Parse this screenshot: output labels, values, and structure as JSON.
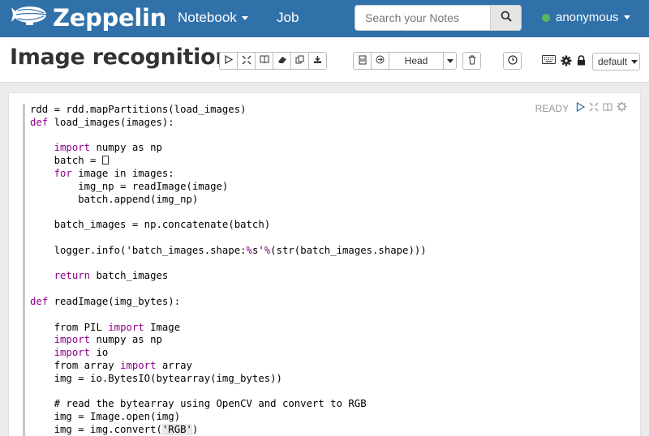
{
  "navbar": {
    "brand": "Zeppelin",
    "notebook_label": "Notebook",
    "job_label": "Job",
    "search_placeholder": "Search your Notes",
    "username": "anonymous",
    "status_color": "#5cb85c"
  },
  "notebook": {
    "title": "Image recognition",
    "head_label": "Head",
    "interpreter_binding": "default",
    "toolbar_icons": [
      "run-all-icon",
      "toggle-code-icon",
      "toggle-output-icon",
      "clear-output-icon",
      "clone-icon",
      "export-icon",
      "version-control-icon",
      "commit-icon",
      "delete-icon",
      "scheduler-icon",
      "shortcut-icon",
      "interpreter-settings-icon",
      "permissions-icon"
    ]
  },
  "paragraph": {
    "status": "READY",
    "control_icons": [
      "run-paragraph-icon",
      "hide-editor-icon",
      "hide-output-icon",
      "settings-icon"
    ]
  },
  "code": [
    {
      "indent": 0,
      "tokens": [
        {
          "t": "rdd = rdd.mapPartitions(load_images)"
        }
      ]
    },
    {
      "indent": 0,
      "tokens": [
        {
          "t": "def",
          "k": 1
        },
        {
          "t": " load_images(images):"
        }
      ]
    },
    {
      "indent": 0,
      "tokens": []
    },
    {
      "indent": 4,
      "tokens": [
        {
          "t": "import",
          "k": 1
        },
        {
          "t": " numpy as np"
        }
      ]
    },
    {
      "indent": 4,
      "tokens": [
        {
          "t": "batch = "
        },
        {
          "t": "[]",
          "box": 1
        }
      ]
    },
    {
      "indent": 4,
      "tokens": [
        {
          "t": "for",
          "k": 1
        },
        {
          "t": " image in images:"
        }
      ]
    },
    {
      "indent": 8,
      "tokens": [
        {
          "t": "img_np = readImage(image)"
        }
      ]
    },
    {
      "indent": 8,
      "tokens": [
        {
          "t": "batch.append(img_np)"
        }
      ]
    },
    {
      "indent": 0,
      "tokens": []
    },
    {
      "indent": 4,
      "tokens": [
        {
          "t": "batch_images = np.concatenate(batch)"
        }
      ]
    },
    {
      "indent": 0,
      "tokens": []
    },
    {
      "indent": 4,
      "tokens": [
        {
          "t": "logger.info('batch_images.shape:"
        },
        {
          "t": "%",
          "k": 1
        },
        {
          "t": "s'"
        },
        {
          "t": "%",
          "k": 1
        },
        {
          "t": "(str(batch_images.shape)))"
        }
      ]
    },
    {
      "indent": 0,
      "tokens": []
    },
    {
      "indent": 4,
      "tokens": [
        {
          "t": "return",
          "k": 1
        },
        {
          "t": " batch_images"
        }
      ]
    },
    {
      "indent": 0,
      "tokens": []
    },
    {
      "indent": 0,
      "tokens": [
        {
          "t": "def",
          "k": 1
        },
        {
          "t": " readImage(img_bytes):"
        }
      ]
    },
    {
      "indent": 0,
      "tokens": []
    },
    {
      "indent": 4,
      "tokens": [
        {
          "t": "from PIL "
        },
        {
          "t": "import",
          "k": 1
        },
        {
          "t": " Image"
        }
      ]
    },
    {
      "indent": 4,
      "tokens": [
        {
          "t": "import",
          "k": 1
        },
        {
          "t": " numpy as np"
        }
      ]
    },
    {
      "indent": 4,
      "tokens": [
        {
          "t": "import",
          "k": 1
        },
        {
          "t": " io"
        }
      ]
    },
    {
      "indent": 4,
      "tokens": [
        {
          "t": "from array "
        },
        {
          "t": "import",
          "k": 1
        },
        {
          "t": " array"
        }
      ]
    },
    {
      "indent": 4,
      "tokens": [
        {
          "t": "img = io.BytesIO(bytearray(img_bytes))"
        }
      ]
    },
    {
      "indent": 0,
      "tokens": []
    },
    {
      "indent": 4,
      "tokens": [
        {
          "t": "# read the bytearray using OpenCV and convert to RGB"
        }
      ]
    },
    {
      "indent": 4,
      "tokens": [
        {
          "t": "img = Image.open(img)"
        }
      ]
    },
    {
      "indent": 4,
      "tokens": [
        {
          "t": "img = img.convert("
        },
        {
          "t": "'RGB'",
          "sel": 1
        },
        {
          "t": ")"
        }
      ]
    }
  ]
}
